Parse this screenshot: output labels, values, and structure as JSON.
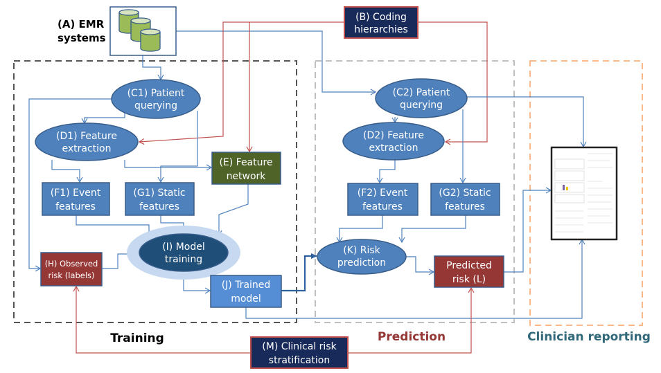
{
  "nodes": {
    "A": {
      "line1": "(A) EMR",
      "line2": "systems"
    },
    "B": {
      "line1": "(B) Coding",
      "line2": "hierarchies"
    },
    "C1": {
      "line1": "(C1) Patient",
      "line2": "querying"
    },
    "D1": {
      "line1": "(D1) Feature",
      "line2": "extraction"
    },
    "E": {
      "line1": "(E) Feature",
      "line2": "network"
    },
    "F1": {
      "line1": "(F1) Event",
      "line2": "features"
    },
    "G1": {
      "line1": "(G1) Static",
      "line2": "features"
    },
    "H": {
      "line1": "(H) Observed",
      "line2": "risk (labels)"
    },
    "I": {
      "line1": "(I) Model",
      "line2": "training"
    },
    "J": {
      "line1": "(J) Trained",
      "line2": "model"
    },
    "C2": {
      "line1": "(C2) Patient",
      "line2": "querying"
    },
    "D2": {
      "line1": "(D2)  Feature",
      "line2": "extraction"
    },
    "F2": {
      "line1": "(F2) Event",
      "line2": "features"
    },
    "G2": {
      "line1": "(G2) Static",
      "line2": "features"
    },
    "K": {
      "line1": "(K) Risk",
      "line2": "prediction"
    },
    "L": {
      "line1": "Predicted",
      "line2": "risk (L)"
    },
    "M": {
      "line1": "(M) Clinical risk",
      "line2": "stratification"
    }
  },
  "sections": {
    "training": "Training",
    "prediction": "Prediction",
    "clinician": "Clinician reporting"
  },
  "colors": {
    "node_blue": "#4f81bd",
    "model_dark": "#1f4e79",
    "navy": "#172a5a",
    "red_box": "#953735",
    "olive": "#4f6228",
    "prediction_label": "#953735",
    "clinician_label": "#31697a",
    "clinician_border": "#f9b98a"
  }
}
